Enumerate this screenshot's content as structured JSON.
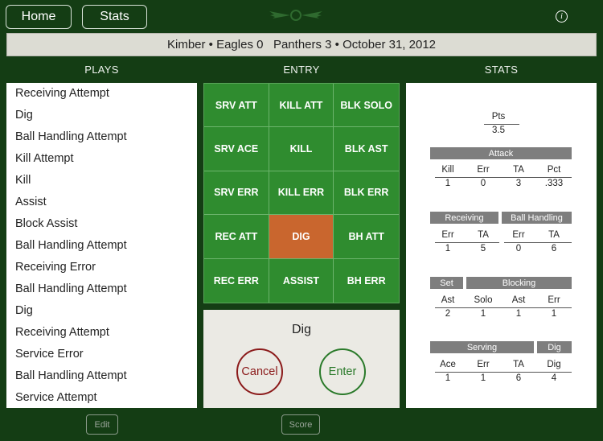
{
  "nav": {
    "home_label": "Home",
    "stats_label": "Stats",
    "info_label": "i"
  },
  "match": {
    "summary": "Kimber • Eagles 0   Panthers 3 • October 31, 2012"
  },
  "columns": {
    "plays": "PLAYS",
    "entry": "ENTRY",
    "stats": "STATS"
  },
  "plays": [
    "Receiving Attempt",
    "Dig",
    "Ball Handling Attempt",
    "Kill Attempt",
    "Kill",
    "Assist",
    "Block Assist",
    "Ball Handling Attempt",
    "Receiving Error",
    "Ball Handling Attempt",
    "Dig",
    "Receiving Attempt",
    "Service Error",
    "Ball Handling Attempt",
    "Service Attempt"
  ],
  "entry": {
    "buttons": [
      "SRV ATT",
      "KILL ATT",
      "BLK SOLO",
      "SRV ACE",
      "KILL",
      "BLK AST",
      "SRV ERR",
      "KILL ERR",
      "BLK ERR",
      "REC ATT",
      "DIG",
      "BH ATT",
      "REC ERR",
      "ASSIST",
      "BH ERR"
    ],
    "selected": "DIG",
    "confirm_title": "Dig",
    "cancel_label": "Cancel",
    "enter_label": "Enter"
  },
  "stats": {
    "pts": {
      "label": "Pts",
      "value": "3.5"
    },
    "attack": {
      "title": "Attack",
      "headers": [
        "Kill",
        "Err",
        "TA",
        "Pct"
      ],
      "values": [
        "1",
        "0",
        "3",
        ".333"
      ]
    },
    "receiving": {
      "title": "Receiving",
      "headers": [
        "Err",
        "TA"
      ],
      "values": [
        "1",
        "5"
      ]
    },
    "ball_handling": {
      "title": "Ball Handling",
      "headers": [
        "Err",
        "TA"
      ],
      "values": [
        "0",
        "6"
      ]
    },
    "set": {
      "title": "Set",
      "headers": [
        "Ast"
      ],
      "values": [
        "2"
      ]
    },
    "blocking": {
      "title": "Blocking",
      "headers": [
        "Solo",
        "Ast",
        "Err"
      ],
      "values": [
        "1",
        "1",
        "1"
      ]
    },
    "serving": {
      "title": "Serving",
      "headers": [
        "Ace",
        "Err",
        "TA"
      ],
      "values": [
        "1",
        "1",
        "6"
      ]
    },
    "dig": {
      "title": "Dig",
      "headers": [
        "Dig"
      ],
      "values": [
        "4"
      ]
    }
  },
  "footer": {
    "edit_label": "Edit",
    "score_label": "Score"
  },
  "colors": {
    "background": "#143d14",
    "entry_green": "#2f8c2f",
    "selected_orange": "#c9662e",
    "cancel_red": "#8b1a1a",
    "enter_green": "#2a7a2a"
  }
}
